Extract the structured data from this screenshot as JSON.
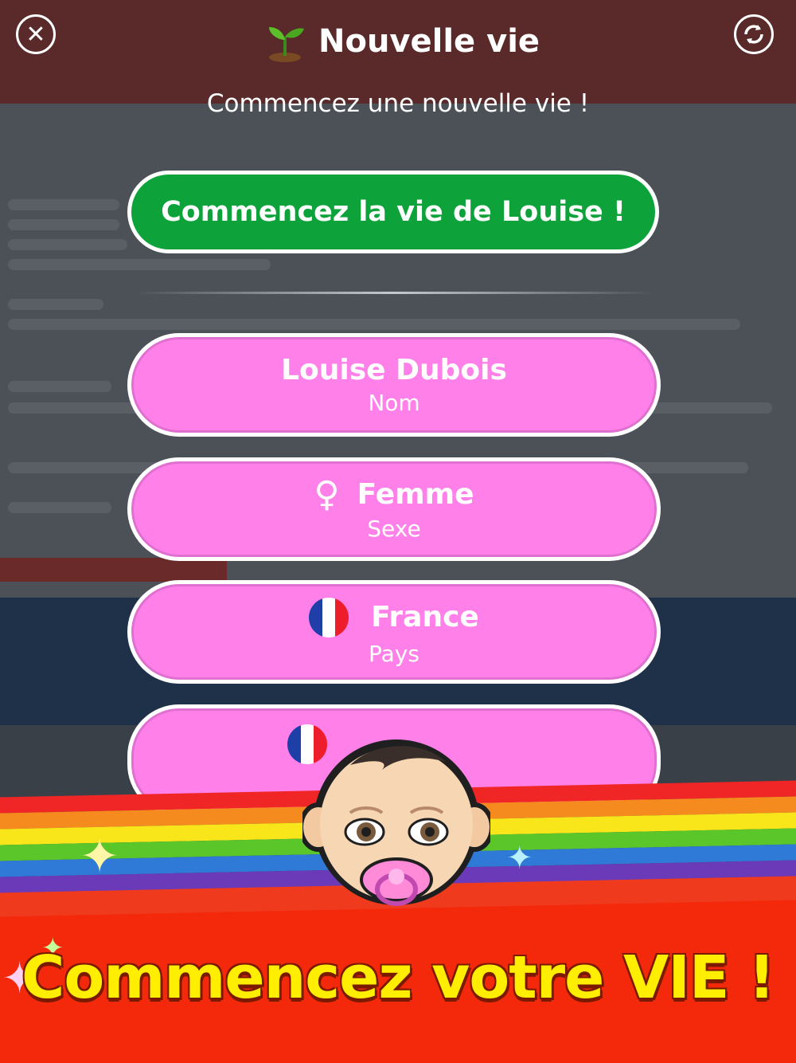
{
  "header": {
    "title": "Nouvelle vie",
    "subtitle": "Commencez une nouvelle vie !",
    "close_icon": "close-icon",
    "refresh_icon": "refresh-icon",
    "sprout_icon": "sprout-icon"
  },
  "start_button": {
    "label": "Commencez la vie de Louise !"
  },
  "options": {
    "name": {
      "value": "Louise Dubois",
      "label": "Nom"
    },
    "sex": {
      "value": "Femme",
      "label": "Sexe",
      "icon": "female-symbol-icon"
    },
    "country": {
      "value": "France",
      "label": "Pays",
      "icon": "france-flag-icon"
    },
    "city": {
      "icon": "france-flag-icon"
    }
  },
  "promo": {
    "text": "Commencez votre VIE !"
  },
  "colors": {
    "green_button": "#0ea33a",
    "pink_button": "#ff80e8",
    "promo_text": "#ffee00",
    "promo_band": "#f4280a"
  }
}
